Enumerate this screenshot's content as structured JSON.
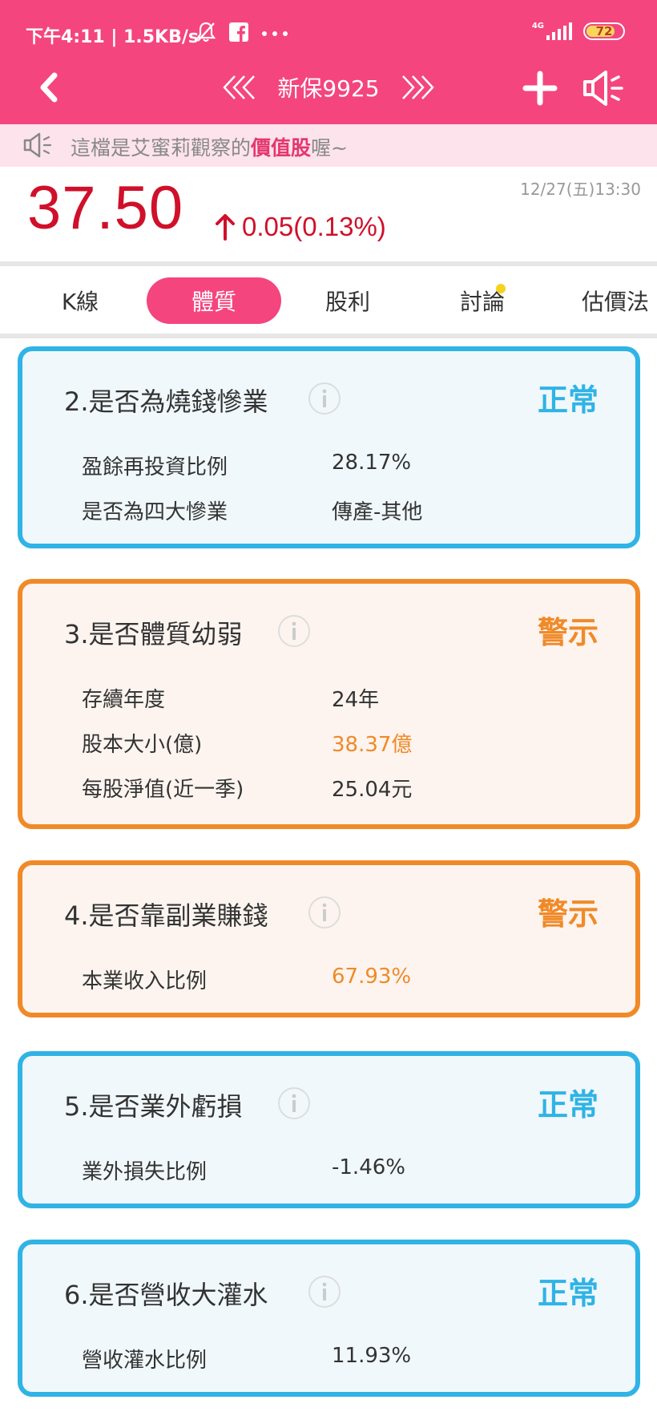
{
  "status_bar": {
    "time_text": "下午4:11 | 1.5KB/s",
    "network_label": "4G",
    "battery": "72",
    "icons": [
      "muted-bell-icon",
      "facebook-icon",
      "more-dots-icon",
      "signal-icon",
      "battery-icon"
    ]
  },
  "nav": {
    "title": "新保9925",
    "icons": [
      "back-chevron-icon",
      "prev-double-chevron-icon",
      "next-double-chevron-icon",
      "plus-icon",
      "speaker-icon"
    ]
  },
  "marquee": {
    "prefix": "這檔是艾蜜莉觀察的",
    "highlight": "價值股",
    "suffix": "喔~"
  },
  "quote": {
    "date": "12/27(五)13:30",
    "price": "37.50",
    "change": "0.05(0.13%)",
    "direction": "up"
  },
  "tabs": [
    {
      "label": "K線"
    },
    {
      "label": "體質",
      "active": true
    },
    {
      "label": "股利"
    },
    {
      "label": "討論",
      "has_dot": true
    },
    {
      "label": "估價法"
    }
  ],
  "cards": [
    {
      "title": "2.是否為燒錢慘業",
      "status": "正常",
      "level": "normal",
      "rows": [
        {
          "label": "盈餘再投資比例",
          "value": "28.17%"
        },
        {
          "label": "是否為四大慘業",
          "value": "傳產-其他"
        }
      ]
    },
    {
      "title": "3.是否體質幼弱",
      "status": "警示",
      "level": "warn",
      "rows": [
        {
          "label": "存續年度",
          "value": "24年"
        },
        {
          "label": "股本大小(億)",
          "value": "38.37億",
          "highlight": true
        },
        {
          "label": "每股淨值(近一季)",
          "value": "25.04元"
        }
      ]
    },
    {
      "title": "4.是否靠副業賺錢",
      "status": "警示",
      "level": "warn",
      "rows": [
        {
          "label": "本業收入比例",
          "value": "67.93%",
          "highlight": true
        }
      ]
    },
    {
      "title": "5.是否業外虧損",
      "status": "正常",
      "level": "normal",
      "rows": [
        {
          "label": "業外損失比例",
          "value": "-1.46%"
        }
      ]
    },
    {
      "title": "6.是否營收大灌水",
      "status": "正常",
      "level": "normal",
      "rows": [
        {
          "label": "營收灌水比例",
          "value": "11.93%"
        }
      ]
    }
  ],
  "colors": {
    "brand_pink": "#f4457f",
    "price_red": "#d0102a",
    "normal_blue": "#30b3e5",
    "warn_orange": "#f08a28"
  }
}
